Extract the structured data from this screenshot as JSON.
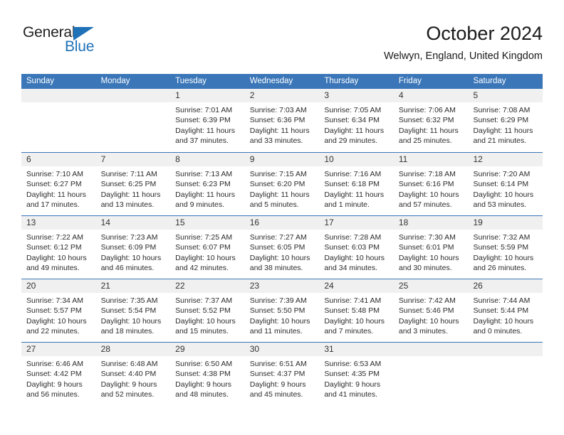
{
  "brand": {
    "name_top": "General",
    "name_bottom": "Blue",
    "triangle_color": "#1f71b8",
    "text_color": "#222222"
  },
  "header": {
    "title": "October 2024",
    "subtitle": "Welwyn, England, United Kingdom"
  },
  "theme": {
    "header_band": "#3a76b8",
    "day_band": "#f0f0f0",
    "row_divider": "#3a76b8",
    "accent_blue": "#1f71b8"
  },
  "weekdays": [
    "Sunday",
    "Monday",
    "Tuesday",
    "Wednesday",
    "Thursday",
    "Friday",
    "Saturday"
  ],
  "labels": {
    "sunrise_prefix": "Sunrise:",
    "sunset_prefix": "Sunset:",
    "daylight_prefix": "Daylight:"
  },
  "weeks": [
    [
      {
        "day": "",
        "empty": true
      },
      {
        "day": "",
        "empty": true
      },
      {
        "day": "1",
        "sunrise": "Sunrise: 7:01 AM",
        "sunset": "Sunset: 6:39 PM",
        "daylight1": "Daylight: 11 hours",
        "daylight2": "and 37 minutes."
      },
      {
        "day": "2",
        "sunrise": "Sunrise: 7:03 AM",
        "sunset": "Sunset: 6:36 PM",
        "daylight1": "Daylight: 11 hours",
        "daylight2": "and 33 minutes."
      },
      {
        "day": "3",
        "sunrise": "Sunrise: 7:05 AM",
        "sunset": "Sunset: 6:34 PM",
        "daylight1": "Daylight: 11 hours",
        "daylight2": "and 29 minutes."
      },
      {
        "day": "4",
        "sunrise": "Sunrise: 7:06 AM",
        "sunset": "Sunset: 6:32 PM",
        "daylight1": "Daylight: 11 hours",
        "daylight2": "and 25 minutes."
      },
      {
        "day": "5",
        "sunrise": "Sunrise: 7:08 AM",
        "sunset": "Sunset: 6:29 PM",
        "daylight1": "Daylight: 11 hours",
        "daylight2": "and 21 minutes."
      }
    ],
    [
      {
        "day": "6",
        "sunrise": "Sunrise: 7:10 AM",
        "sunset": "Sunset: 6:27 PM",
        "daylight1": "Daylight: 11 hours",
        "daylight2": "and 17 minutes."
      },
      {
        "day": "7",
        "sunrise": "Sunrise: 7:11 AM",
        "sunset": "Sunset: 6:25 PM",
        "daylight1": "Daylight: 11 hours",
        "daylight2": "and 13 minutes."
      },
      {
        "day": "8",
        "sunrise": "Sunrise: 7:13 AM",
        "sunset": "Sunset: 6:23 PM",
        "daylight1": "Daylight: 11 hours",
        "daylight2": "and 9 minutes."
      },
      {
        "day": "9",
        "sunrise": "Sunrise: 7:15 AM",
        "sunset": "Sunset: 6:20 PM",
        "daylight1": "Daylight: 11 hours",
        "daylight2": "and 5 minutes."
      },
      {
        "day": "10",
        "sunrise": "Sunrise: 7:16 AM",
        "sunset": "Sunset: 6:18 PM",
        "daylight1": "Daylight: 11 hours",
        "daylight2": "and 1 minute."
      },
      {
        "day": "11",
        "sunrise": "Sunrise: 7:18 AM",
        "sunset": "Sunset: 6:16 PM",
        "daylight1": "Daylight: 10 hours",
        "daylight2": "and 57 minutes."
      },
      {
        "day": "12",
        "sunrise": "Sunrise: 7:20 AM",
        "sunset": "Sunset: 6:14 PM",
        "daylight1": "Daylight: 10 hours",
        "daylight2": "and 53 minutes."
      }
    ],
    [
      {
        "day": "13",
        "sunrise": "Sunrise: 7:22 AM",
        "sunset": "Sunset: 6:12 PM",
        "daylight1": "Daylight: 10 hours",
        "daylight2": "and 49 minutes."
      },
      {
        "day": "14",
        "sunrise": "Sunrise: 7:23 AM",
        "sunset": "Sunset: 6:09 PM",
        "daylight1": "Daylight: 10 hours",
        "daylight2": "and 46 minutes."
      },
      {
        "day": "15",
        "sunrise": "Sunrise: 7:25 AM",
        "sunset": "Sunset: 6:07 PM",
        "daylight1": "Daylight: 10 hours",
        "daylight2": "and 42 minutes."
      },
      {
        "day": "16",
        "sunrise": "Sunrise: 7:27 AM",
        "sunset": "Sunset: 6:05 PM",
        "daylight1": "Daylight: 10 hours",
        "daylight2": "and 38 minutes."
      },
      {
        "day": "17",
        "sunrise": "Sunrise: 7:28 AM",
        "sunset": "Sunset: 6:03 PM",
        "daylight1": "Daylight: 10 hours",
        "daylight2": "and 34 minutes."
      },
      {
        "day": "18",
        "sunrise": "Sunrise: 7:30 AM",
        "sunset": "Sunset: 6:01 PM",
        "daylight1": "Daylight: 10 hours",
        "daylight2": "and 30 minutes."
      },
      {
        "day": "19",
        "sunrise": "Sunrise: 7:32 AM",
        "sunset": "Sunset: 5:59 PM",
        "daylight1": "Daylight: 10 hours",
        "daylight2": "and 26 minutes."
      }
    ],
    [
      {
        "day": "20",
        "sunrise": "Sunrise: 7:34 AM",
        "sunset": "Sunset: 5:57 PM",
        "daylight1": "Daylight: 10 hours",
        "daylight2": "and 22 minutes."
      },
      {
        "day": "21",
        "sunrise": "Sunrise: 7:35 AM",
        "sunset": "Sunset: 5:54 PM",
        "daylight1": "Daylight: 10 hours",
        "daylight2": "and 18 minutes."
      },
      {
        "day": "22",
        "sunrise": "Sunrise: 7:37 AM",
        "sunset": "Sunset: 5:52 PM",
        "daylight1": "Daylight: 10 hours",
        "daylight2": "and 15 minutes."
      },
      {
        "day": "23",
        "sunrise": "Sunrise: 7:39 AM",
        "sunset": "Sunset: 5:50 PM",
        "daylight1": "Daylight: 10 hours",
        "daylight2": "and 11 minutes."
      },
      {
        "day": "24",
        "sunrise": "Sunrise: 7:41 AM",
        "sunset": "Sunset: 5:48 PM",
        "daylight1": "Daylight: 10 hours",
        "daylight2": "and 7 minutes."
      },
      {
        "day": "25",
        "sunrise": "Sunrise: 7:42 AM",
        "sunset": "Sunset: 5:46 PM",
        "daylight1": "Daylight: 10 hours",
        "daylight2": "and 3 minutes."
      },
      {
        "day": "26",
        "sunrise": "Sunrise: 7:44 AM",
        "sunset": "Sunset: 5:44 PM",
        "daylight1": "Daylight: 10 hours",
        "daylight2": "and 0 minutes."
      }
    ],
    [
      {
        "day": "27",
        "sunrise": "Sunrise: 6:46 AM",
        "sunset": "Sunset: 4:42 PM",
        "daylight1": "Daylight: 9 hours",
        "daylight2": "and 56 minutes."
      },
      {
        "day": "28",
        "sunrise": "Sunrise: 6:48 AM",
        "sunset": "Sunset: 4:40 PM",
        "daylight1": "Daylight: 9 hours",
        "daylight2": "and 52 minutes."
      },
      {
        "day": "29",
        "sunrise": "Sunrise: 6:50 AM",
        "sunset": "Sunset: 4:38 PM",
        "daylight1": "Daylight: 9 hours",
        "daylight2": "and 48 minutes."
      },
      {
        "day": "30",
        "sunrise": "Sunrise: 6:51 AM",
        "sunset": "Sunset: 4:37 PM",
        "daylight1": "Daylight: 9 hours",
        "daylight2": "and 45 minutes."
      },
      {
        "day": "31",
        "sunrise": "Sunrise: 6:53 AM",
        "sunset": "Sunset: 4:35 PM",
        "daylight1": "Daylight: 9 hours",
        "daylight2": "and 41 minutes."
      },
      {
        "day": "",
        "empty": true
      },
      {
        "day": "",
        "empty": true
      }
    ]
  ]
}
